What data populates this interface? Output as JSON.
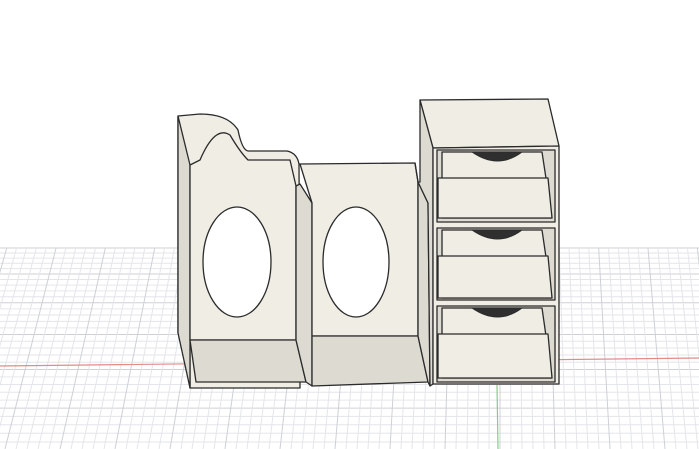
{
  "viewport": {
    "background": "#ffffff",
    "grid": {
      "visible": true,
      "minor_color": "#e3e6ea",
      "major_color": "#cdd1d6",
      "x_axis_color": "#e38a8a",
      "y_axis_color": "#7fcf86"
    }
  },
  "model": {
    "body_color": "#efede4",
    "shade_color": "#dcdad1",
    "edge_color": "#2b2b2b",
    "hole_color": "#ffffff",
    "knob_color": "#2f2f2f",
    "drawers": [
      {
        "label": ""
      },
      {
        "label": ""
      },
      {
        "label": ""
      }
    ]
  }
}
